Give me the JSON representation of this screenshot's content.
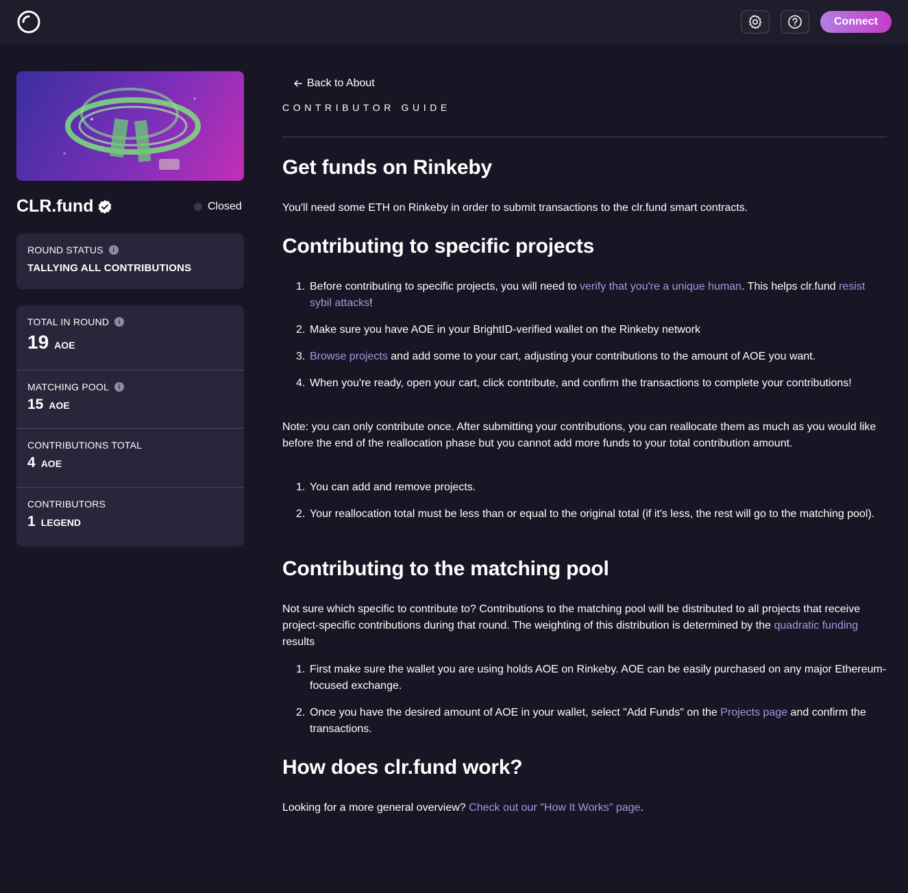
{
  "topbar": {
    "connect_label": "Connect",
    "settings_icon": "gear-icon",
    "help_icon": "question-icon"
  },
  "sidebar": {
    "round_name": "CLR.fund",
    "status": "Closed",
    "round_status_label": "ROUND STATUS",
    "round_status_value": "TALLYING ALL CONTRIBUTIONS",
    "stats": [
      {
        "label": "TOTAL IN ROUND",
        "value": "19",
        "unit": "AOE"
      },
      {
        "label": "MATCHING POOL",
        "value": "15",
        "unit": "AOE"
      },
      {
        "label": "CONTRIBUTIONS TOTAL",
        "value": "4",
        "unit": "AOE"
      },
      {
        "label": "CONTRIBUTORS",
        "value": "1",
        "unit": "LEGEND"
      }
    ]
  },
  "main": {
    "back_link": "Back to About",
    "guide_label": "CONTRIBUTOR GUIDE",
    "section1": {
      "title": "Get funds on Rinkeby",
      "text": "You'll need some ETH on Rinkeby in order to submit transactions to the clr.fund smart contracts."
    },
    "section2": {
      "title": "Contributing to specific projects",
      "items": [
        {
          "num": "1.",
          "pre": "Before contributing to specific projects, you will need to ",
          "link1": "verify that you're a unique human",
          "mid": ". This helps clr.fund ",
          "link2": "resist sybil attacks",
          "post": "!"
        },
        {
          "num": "2.",
          "text": "Make sure you have AOE in your BrightID-verified wallet on the Rinkeby network"
        },
        {
          "num": "3.",
          "link": "Browse projects",
          "text": " and add some to your cart, adjusting your contributions to the amount of AOE you want."
        },
        {
          "num": "4.",
          "text": "When you're ready, open your cart, click contribute, and confirm the transactions to complete your contributions!"
        }
      ],
      "note": "Note: you can only contribute once. After submitting your contributions, you can reallocate them as much as you would like before the end of the reallocation phase but you cannot add more funds to your total contribution amount.",
      "items2": [
        {
          "num": "1.",
          "text": "You can add and remove projects."
        },
        {
          "num": "2.",
          "text": "Your reallocation total must be less than or equal to the original total (if it's less, the rest will go to the matching pool)."
        }
      ]
    },
    "section3": {
      "title": "Contributing to the matching pool",
      "text_pre": "Not sure which specific to contribute to? Contributions to the matching pool will be distributed to all projects that receive project-specific contributions during that round. The weighting of this distribution is determined by the ",
      "text_link": "quadratic funding",
      "text_post": " results",
      "items": [
        {
          "num": "1.",
          "text": "First make sure the wallet you are using holds AOE on Rinkeby. AOE can be easily purchased on any major Ethereum-focused exchange."
        },
        {
          "num": "2.",
          "pre": "Once you have the desired amount of AOE in your wallet, select \"Add Funds\" on the ",
          "link": "Projects page",
          "post": " and confirm the transactions."
        }
      ]
    },
    "section4": {
      "title": "How does clr.fund work?",
      "pre": "Looking for a more general overview? ",
      "link": "Check out our \"How It Works\" page",
      "post": "."
    }
  },
  "colors": {
    "background": "#181624",
    "topbar": "#1f1d2b",
    "card": "#28263a",
    "link": "#a895e0",
    "accent_start": "#b47ee0",
    "accent_end": "#c43dc9"
  }
}
